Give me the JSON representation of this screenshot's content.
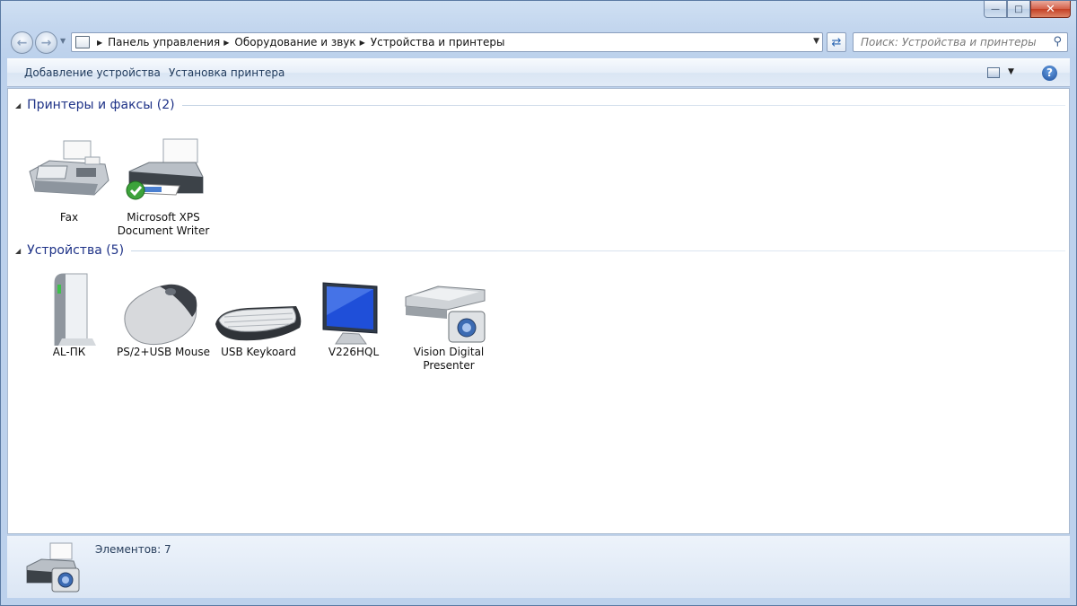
{
  "window": {
    "caption_buttons": {
      "minimize": "—",
      "maximize": "□",
      "close": "✕"
    }
  },
  "address_bar": {
    "breadcrumbs": [
      "Панель управления",
      "Оборудование и звук",
      "Устройства и принтеры"
    ]
  },
  "search": {
    "placeholder": "Поиск: Устройства и принтеры",
    "icon": "search-icon"
  },
  "toolbar": {
    "add_device": "Добавление устройства",
    "add_printer": "Установка принтера",
    "help_label": "?"
  },
  "groups": [
    {
      "title": "Принтеры и факсы (2)",
      "items": [
        {
          "label_lines": [
            "Fax"
          ],
          "icon": "fax-icon"
        },
        {
          "label_lines": [
            "Microsoft XPS",
            "Document Writer"
          ],
          "icon": "printer-icon",
          "default": true
        }
      ]
    },
    {
      "title": "Устройства (5)",
      "items": [
        {
          "label_lines": [
            "AL-ПК"
          ],
          "icon": "computer-icon"
        },
        {
          "label_lines": [
            "PS/2+USB Mouse"
          ],
          "icon": "mouse-icon"
        },
        {
          "label_lines": [
            "USB Keykoard"
          ],
          "icon": "keyboard-icon"
        },
        {
          "label_lines": [
            "V226HQL"
          ],
          "icon": "monitor-icon"
        },
        {
          "label_lines": [
            "Vision Digital",
            "Presenter"
          ],
          "icon": "scanner-camera-icon"
        }
      ]
    }
  ],
  "status_bar": {
    "text": "Элементов: 7",
    "icon": "devices-printers-icon"
  }
}
